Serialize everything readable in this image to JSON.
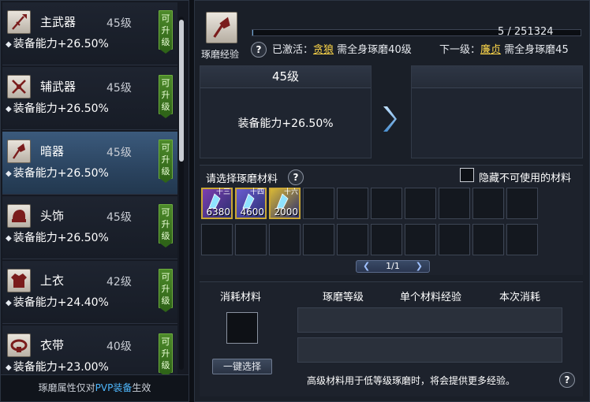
{
  "left_panel": {
    "items": [
      {
        "name": "主武器",
        "level": "45级",
        "stat": "装备能力+26.50%",
        "badge": "可升级",
        "icon": "spear-icon",
        "selected": false
      },
      {
        "name": "辅武器",
        "level": "45级",
        "stat": "装备能力+26.50%",
        "badge": "可升级",
        "icon": "crossed-blades-icon",
        "selected": false
      },
      {
        "name": "暗器",
        "level": "45级",
        "stat": "装备能力+26.50%",
        "badge": "可升级",
        "icon": "hidden-weapon-icon",
        "selected": true
      },
      {
        "name": "头饰",
        "level": "45级",
        "stat": "装备能力+26.50%",
        "badge": "可升级",
        "icon": "helmet-icon",
        "selected": false
      },
      {
        "name": "上衣",
        "level": "42级",
        "stat": "装备能力+24.40%",
        "badge": "可升级",
        "icon": "armor-icon",
        "selected": false
      },
      {
        "name": "衣带",
        "level": "40级",
        "stat": "装备能力+23.00%",
        "badge": "可升级",
        "icon": "belt-icon",
        "selected": false
      }
    ],
    "footer": {
      "prefix": "琢磨属性仅对",
      "highlight": "PVP装备",
      "suffix": "生效"
    }
  },
  "header": {
    "icon": "hidden-weapon-icon",
    "icon_label": "琢磨经验",
    "xp_text": "5 / 251324",
    "xp_fraction": 2e-05,
    "help": "?",
    "activated_prefix": "已激活：",
    "activated_name": "贪狼",
    "activated_desc": "需全身琢磨40级",
    "next_prefix": "下一级：",
    "next_name": "廉贞",
    "next_desc": "需全身琢磨45"
  },
  "current_level": {
    "level": "45级",
    "stat": "装备能力+26.50%"
  },
  "next_level": {
    "level": "",
    "stat": ""
  },
  "materials": {
    "title": "请选择琢磨材料",
    "help": "?",
    "hide_label": "隐藏不可使用的材料",
    "hide_checked": false,
    "slots": [
      {
        "qty": "6380",
        "tier": "十三",
        "color": "#7c3fb0"
      },
      {
        "qty": "4600",
        "tier": "十四",
        "color": "#6a5cd0"
      },
      {
        "qty": "2000",
        "tier": "十六",
        "color": "#d8b735"
      }
    ],
    "empty_slot_count": 17,
    "pager": {
      "prev": "❮",
      "text": "1/1",
      "next": "❯"
    }
  },
  "consume": {
    "columns": [
      "消耗材料",
      "琢磨等级",
      "单个材料经验",
      "本次消耗"
    ],
    "one_click_label": "一键选择",
    "footnote": "高级材料用于低等级琢磨时，将会提供更多经验。",
    "help": "?"
  },
  "colors": {
    "accent_gold": "#ffd84a",
    "pvp_blue": "#4fb9ff",
    "badge_green": "#3f7a22",
    "selected_row": "#2b4460"
  }
}
